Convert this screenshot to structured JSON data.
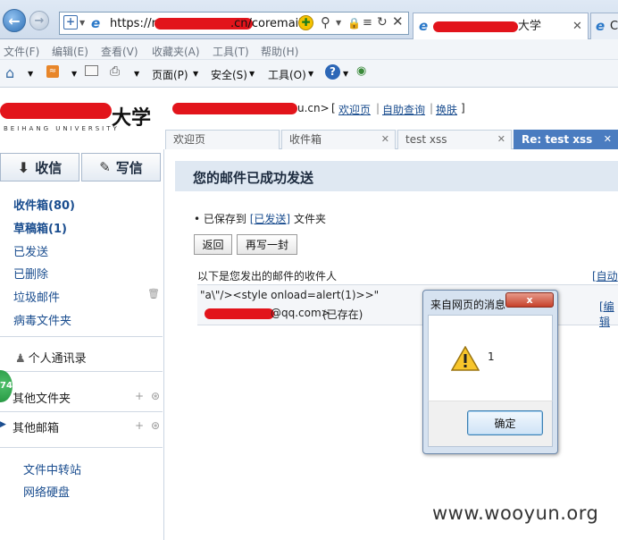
{
  "browser": {
    "url": "https://mail.buaa.edu.cn/coremail/",
    "url_prefix": "https://m",
    "url_suffix": ".cn/coremail/",
    "active_tab_suffix": "大学",
    "next_tab_label": "C"
  },
  "menubar": [
    "文件(F)",
    "编辑(E)",
    "查看(V)",
    "收藏夹(A)",
    "工具(T)",
    "帮助(H)"
  ],
  "commandbar": {
    "page": "页面(P)",
    "safety": "安全(S)",
    "tools": "工具(O)"
  },
  "mail": {
    "logo_text": "大学",
    "logo_sub": "BEIHANG UNIVERSITY",
    "header_user_suffix": "u.cn>",
    "header_links": {
      "welcome": "欢迎页",
      "help": "自助查询",
      "skin": "换肤"
    },
    "tabs": [
      {
        "label": "欢迎页",
        "closable": false
      },
      {
        "label": "收件箱",
        "closable": true
      },
      {
        "label": "test xss",
        "closable": true
      },
      {
        "label": "Re: test xss",
        "closable": true,
        "active": true
      }
    ],
    "sidebar": {
      "receive": "收信",
      "compose": "写信",
      "folders": [
        {
          "label": "收件箱",
          "count": "(80)"
        },
        {
          "label": "草稿箱",
          "count": "(1)"
        },
        {
          "label": "已发送",
          "count": ""
        },
        {
          "label": "已删除",
          "count": ""
        },
        {
          "label": "垃圾邮件",
          "count": ""
        },
        {
          "label": "病毒文件夹",
          "count": ""
        }
      ],
      "contacts": "个人通讯录",
      "other_folders": "其他文件夹",
      "other_mailboxes": "其他邮箱",
      "badge": "74",
      "tools": [
        "文件中转站",
        "网络硬盘"
      ]
    },
    "main": {
      "title": "您的邮件已成功发送",
      "saved_prefix": "已保存到",
      "saved_folder": "[已发送]",
      "saved_suffix": "文件夹",
      "back_button": "返回",
      "write_again_button": "再写一封",
      "recipients_label": "以下是您发出的邮件的收件人",
      "auto_link": "[自动",
      "edit_link": "[编辑",
      "recipient_name": "\"a\\\"/><style onload=alert(1)>>\"",
      "recipient_email_suffix": "@qq.com>",
      "recipient_status": "(已存在)"
    }
  },
  "dialog": {
    "title": "来自网页的消息",
    "message": "1",
    "ok_button": "确定",
    "close_label": "x"
  },
  "watermark": "www.wooyun.org",
  "colors": {
    "accent_blue": "#4a7cc0",
    "link": "#1a4d8f",
    "redaction": "#e2141b"
  }
}
